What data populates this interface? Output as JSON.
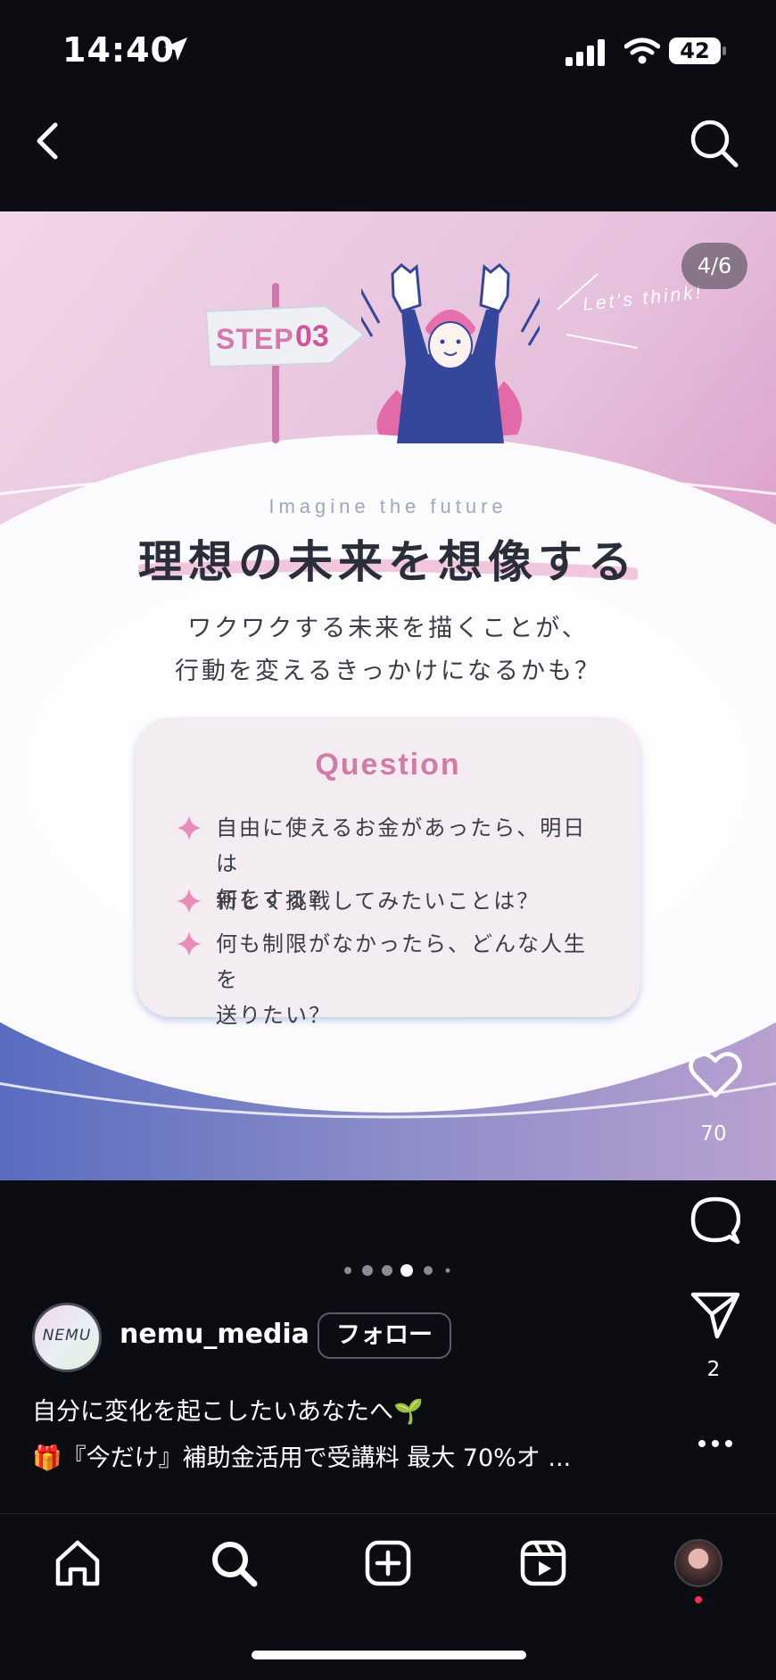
{
  "status_bar": {
    "time": "14:40",
    "battery": "42"
  },
  "post": {
    "page_indicator": "4/6",
    "slide": {
      "step_label": "STEP",
      "step_number": "03",
      "lets_think": "Let's think!",
      "subtitle_en": "Imagine the future",
      "title": "理想の未来を想像する",
      "lead_line_1": "ワクワクする未来を描くことが、",
      "lead_line_2": "行動を変えるきっかけになるかも？",
      "question_title": "Question",
      "questions": [
        {
          "line1": "自由に使えるお金があったら、明日は",
          "line2": "何をする？"
        },
        {
          "line1": "新しく挑戦してみたいことは？"
        },
        {
          "line1": "何も制限がなかったら、どんな人生を",
          "line2": "送りたい？"
        }
      ]
    },
    "like_count": "70",
    "share_count": "2",
    "carousel": {
      "total": 6,
      "current": 4
    }
  },
  "account": {
    "avatar_text": "NEMU",
    "username": "nemu_media",
    "follow_label": "フォロー"
  },
  "caption": {
    "line1": "自分に変化を起こしたいあなたへ🌱",
    "line2": "🎁『今だけ』補助金活用で受講料 最大 70%オ ..."
  },
  "colors": {
    "background": "#0b0d13",
    "accent_pink": "#d27aa8",
    "navy": "#2f4a99"
  },
  "icons": {
    "nav": [
      "chevron-left-icon",
      "search-icon"
    ],
    "actions": [
      "heart-icon",
      "comment-icon",
      "paper-plane-icon",
      "more-icon"
    ],
    "tabs": [
      "home-icon",
      "search-icon",
      "plus-square-icon",
      "reels-icon",
      "profile-avatar"
    ]
  }
}
